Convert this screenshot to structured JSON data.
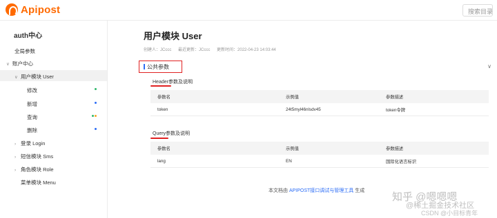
{
  "app": {
    "logo_text": "Apipost"
  },
  "search": {
    "placeholder": "搜索目录"
  },
  "sidebar": {
    "title": "auth中心",
    "items": [
      {
        "label": "全局参数"
      },
      {
        "label": "账户中心"
      },
      {
        "label": "用户模块 User"
      },
      {
        "label": "修改"
      },
      {
        "label": "新增"
      },
      {
        "label": "查询"
      },
      {
        "label": "删除"
      },
      {
        "label": "登录 Login"
      },
      {
        "label": "短信模块 Sms"
      },
      {
        "label": "角色模块 Role"
      },
      {
        "label": "菜单模块 Menu"
      }
    ]
  },
  "main": {
    "title": "用户模块 User",
    "meta": {
      "creator": "创建人：JCccc",
      "updater": "最近更新：JCccc",
      "updated_at": "更新时间：2022-04-23 14:03:44"
    },
    "section": {
      "label": "公共参数"
    },
    "header_params": {
      "title": "Header参数及说明",
      "columns": [
        "参数名",
        "示例值",
        "参数描述"
      ],
      "rows": [
        [
          "token",
          "24t5myl46nlsdv45",
          "token令牌"
        ]
      ]
    },
    "query_params": {
      "title": "Query参数及说明",
      "columns": [
        "参数名",
        "示例值",
        "参数描述"
      ],
      "rows": [
        [
          "lang",
          "EN",
          "国际化语言标识"
        ]
      ]
    },
    "footer": {
      "prefix": "本文档由",
      "link": "APIPOST接口调试与管理工具",
      "suffix": "生成"
    }
  },
  "watermarks": {
    "zhihu": "知乎 @嗯嗯嗯",
    "juejin": "@稀土掘金技术社区",
    "csdn": "CSDN @小目标青年"
  },
  "colors": {
    "brand": "#ff6a00",
    "accent": "#2b6cf6",
    "annotation_red": "#e02020",
    "dot_green": "#2fb86a",
    "dot_blue": "#2b6cf6",
    "dot_orange": "#f5a623"
  }
}
